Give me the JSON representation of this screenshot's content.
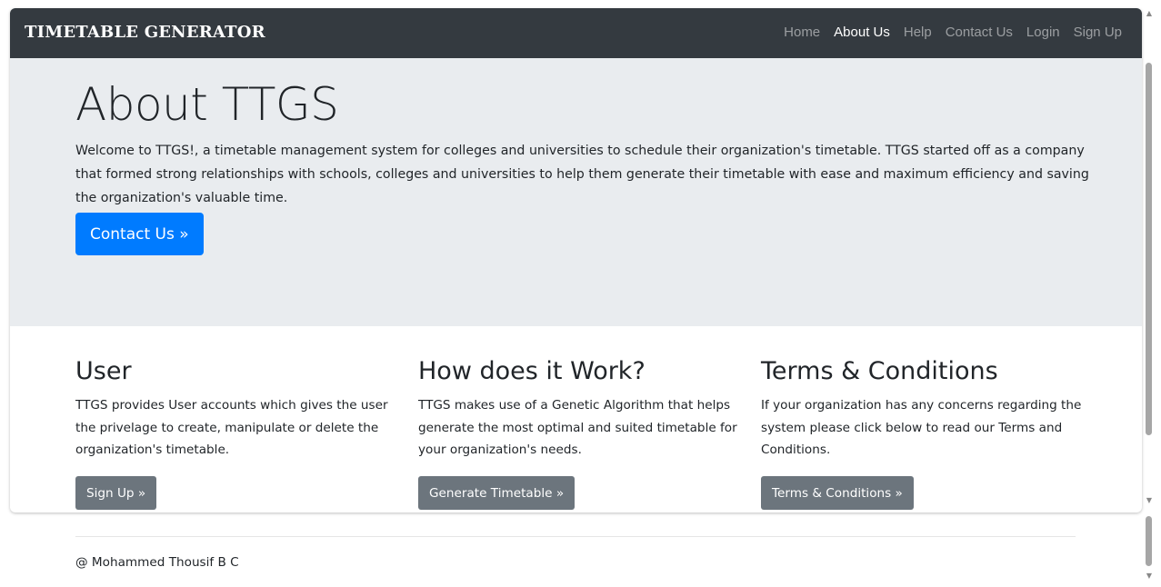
{
  "navbar": {
    "brand": "TIMETABLE GENERATOR",
    "items": [
      {
        "label": "Home",
        "active": false
      },
      {
        "label": "About Us",
        "active": true
      },
      {
        "label": "Help",
        "active": false
      },
      {
        "label": "Contact Us",
        "active": false
      },
      {
        "label": "Login",
        "active": false
      },
      {
        "label": "Sign Up",
        "active": false
      }
    ]
  },
  "jumbotron": {
    "title": "About TTGS",
    "description": "Welcome to TTGS!, a timetable management system for colleges and universities to schedule their organization's timetable. TTGS started off as a company that formed strong relationships with schools, colleges and universities to help them generate their timetable with ease and maximum efficiency and saving the organization's valuable time.",
    "button": "Contact Us »"
  },
  "columns": [
    {
      "heading": "User",
      "text": "TTGS provides User accounts which gives the user the privelage to create, manipulate or delete the organization's timetable.",
      "button": "Sign Up »"
    },
    {
      "heading": "How does it Work?",
      "text": "TTGS makes use of a Genetic Algorithm that helps generate the most optimal and suited timetable for your organization's needs.",
      "button": "Generate Timetable »"
    },
    {
      "heading": "Terms & Conditions",
      "text": "If your organization has any concerns regarding the system please click below to read our Terms and Conditions.",
      "button": "Terms & Conditions »"
    }
  ],
  "footer": {
    "text": "@ Mohammed Thousif B C"
  },
  "colors": {
    "navbar": "#343a40",
    "jumbotron": "#e9ecef",
    "primary": "#007bff",
    "secondary": "#6c757d"
  }
}
